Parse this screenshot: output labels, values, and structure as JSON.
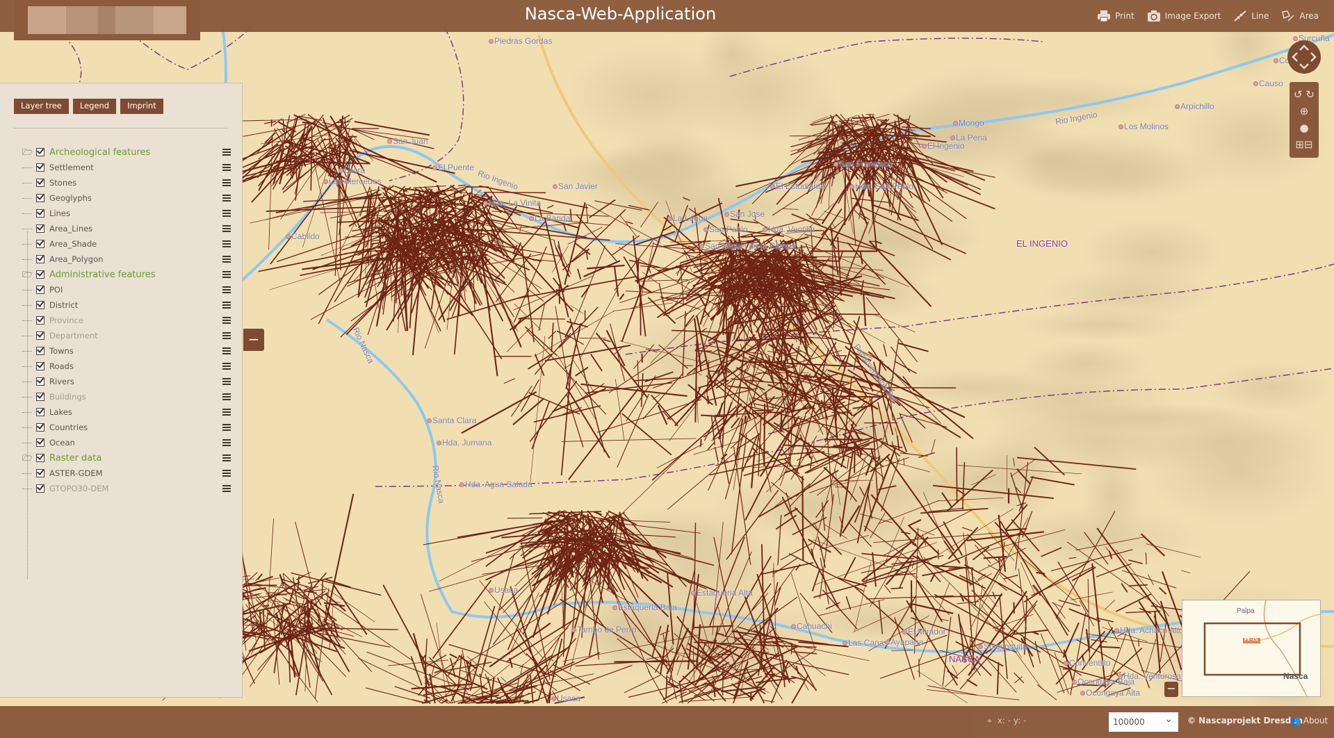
{
  "app": {
    "title": "Nasca-Web-Application"
  },
  "toolbar": [
    {
      "label": "Print",
      "icon": "printer-icon"
    },
    {
      "label": "Image Export",
      "icon": "camera-icon"
    },
    {
      "label": "Line",
      "icon": "measure-line-icon"
    },
    {
      "label": "Area",
      "icon": "measure-area-icon"
    }
  ],
  "panel": {
    "tabs": [
      "Layer tree",
      "Legend",
      "Imprint"
    ],
    "layers": [
      {
        "label": "Archeological features",
        "group": true,
        "checked": true
      },
      {
        "label": "Settlement",
        "checked": true
      },
      {
        "label": "Stones",
        "checked": true
      },
      {
        "label": "Geoglyphs",
        "checked": true
      },
      {
        "label": "Lines",
        "checked": true
      },
      {
        "label": "Area_Lines",
        "checked": true
      },
      {
        "label": "Area_Shade",
        "checked": true
      },
      {
        "label": "Area_Polygon",
        "checked": true
      },
      {
        "label": "Administrative features",
        "group": true,
        "checked": true
      },
      {
        "label": "POI",
        "checked": true
      },
      {
        "label": "District",
        "checked": true
      },
      {
        "label": "Province",
        "checked": true,
        "dim": true
      },
      {
        "label": "Department",
        "checked": true,
        "dim": true
      },
      {
        "label": "Towns",
        "checked": true
      },
      {
        "label": "Roads",
        "checked": true
      },
      {
        "label": "Rivers",
        "checked": true
      },
      {
        "label": "Buildings",
        "checked": true,
        "dim": true
      },
      {
        "label": "Lakes",
        "checked": true
      },
      {
        "label": "Countries",
        "checked": true
      },
      {
        "label": "Ocean",
        "checked": true
      },
      {
        "label": "Raster data",
        "group": true,
        "checked": true
      },
      {
        "label": "ASTER-GDEM",
        "checked": true
      },
      {
        "label": "GTOPO30-DEM",
        "checked": true,
        "dim": true
      }
    ],
    "collapse_label": "−"
  },
  "map": {
    "places": [
      "Piedras Gordas",
      "San Juan",
      "Lacra",
      "Las Mercedes",
      "El Puente",
      "Rio Ingenio",
      "San Javier",
      "Hda. La Vinita",
      "La Banda",
      "Cabildo",
      "La Legua",
      "San Jose",
      "San Pablo",
      "Hda. Ventilla",
      "San Miguel de la Pampa",
      "El Estudiante",
      "San Francisco",
      "Hda. San Pablo",
      "Mongo",
      "La Pena",
      "El Ingenio",
      "Rio Ingenio",
      "Los Molinos",
      "Arpichillo",
      "Causo",
      "Conde",
      "Surcuña",
      "Santa Clara",
      "Hda. Jumana",
      "Hda. Agua Salada",
      "Usaca",
      "Estaqueria Alta",
      "Estaqueria Baja",
      "Tambo de Perro",
      "Cahuachi",
      "Las Canas",
      "Ayapana",
      "El Mirador",
      "Soisonguito",
      "Conventillo",
      "Hda. Achaco Alto",
      "Hda. Venturosa",
      "Ocongaya Baja",
      "Ocongaya Alta",
      "Usaca",
      "Rio Nasca",
      "Rio Nasca",
      "Panamericana Sur"
    ],
    "regions": [
      "EL INGENIO",
      "NASCA"
    ],
    "colors": {
      "lines": "#6e2414",
      "river": "#8fc8ef",
      "road": "#f0c878",
      "terrain": "#f1dfb2",
      "boundary": "#7a3a8a"
    }
  },
  "minimap": {
    "labels": [
      "Palpa",
      "Nasca"
    ],
    "road_badge": "PE-1S",
    "minus_label": "−"
  },
  "footer": {
    "coords": "x: - y: -",
    "scale": "100000",
    "copyright": "© Nascaprojekt Dresden",
    "about": "About"
  }
}
